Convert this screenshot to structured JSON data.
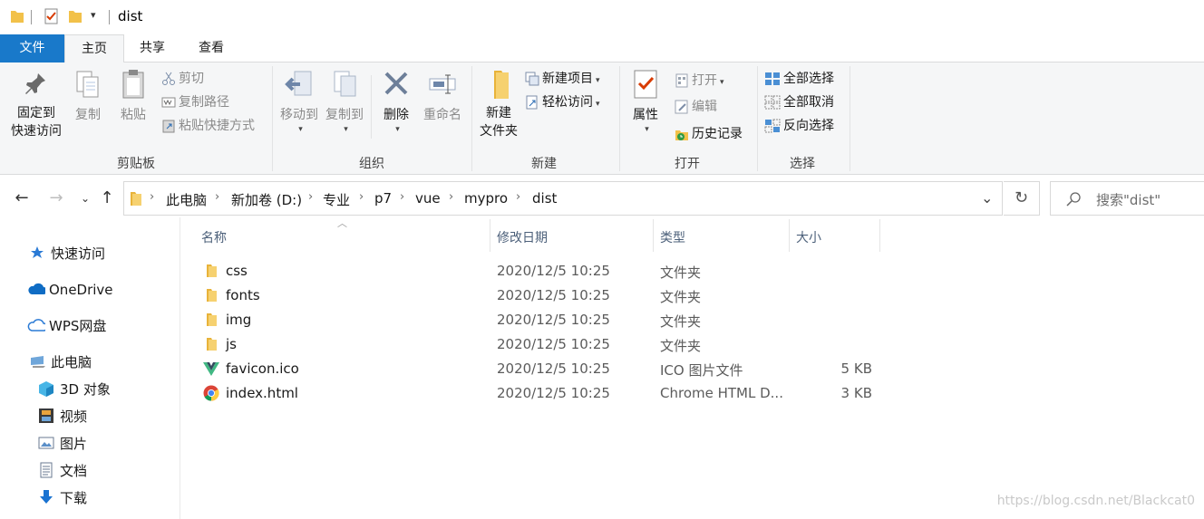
{
  "window": {
    "title": "dist"
  },
  "ribbon_tabs": [
    {
      "label": "文件"
    },
    {
      "label": "主页"
    },
    {
      "label": "共享"
    },
    {
      "label": "查看"
    }
  ],
  "ribbon": {
    "clipboard": {
      "group_label": "剪贴板",
      "pin_label": "固定到\n快速访问",
      "copy_label": "复制",
      "paste_label": "粘贴",
      "cut_label": "剪切",
      "copy_path_label": "复制路径",
      "paste_shortcut_label": "粘贴快捷方式"
    },
    "organize": {
      "group_label": "组织",
      "move_to_label": "移动到",
      "copy_to_label": "复制到",
      "delete_label": "删除",
      "rename_label": "重命名"
    },
    "new": {
      "group_label": "新建",
      "new_folder_label": "新建\n文件夹",
      "new_item_label": "新建项目",
      "easy_access_label": "轻松访问"
    },
    "open": {
      "group_label": "打开",
      "properties_label": "属性",
      "open_label": "打开",
      "edit_label": "编辑",
      "history_label": "历史记录"
    },
    "select": {
      "group_label": "选择",
      "select_all_label": "全部选择",
      "select_none_label": "全部取消",
      "invert_label": "反向选择"
    }
  },
  "address": {
    "crumbs": [
      "此电脑",
      "新加卷 (D:)",
      "专业",
      "p7",
      "vue",
      "mypro",
      "dist"
    ],
    "search_placeholder": "搜索\"dist\""
  },
  "nav_pane": {
    "quick_access": "快速访问",
    "onedrive": "OneDrive",
    "wps": "WPS网盘",
    "this_pc": "此电脑",
    "items": [
      "3D 对象",
      "视频",
      "图片",
      "文档",
      "下载"
    ]
  },
  "columns": {
    "name": "名称",
    "date": "修改日期",
    "type": "类型",
    "size": "大小"
  },
  "files": [
    {
      "name": "css",
      "date": "2020/12/5 10:25",
      "type": "文件夹",
      "size": "",
      "icon": "folder-icon"
    },
    {
      "name": "fonts",
      "date": "2020/12/5 10:25",
      "type": "文件夹",
      "size": "",
      "icon": "folder-icon"
    },
    {
      "name": "img",
      "date": "2020/12/5 10:25",
      "type": "文件夹",
      "size": "",
      "icon": "folder-icon"
    },
    {
      "name": "js",
      "date": "2020/12/5 10:25",
      "type": "文件夹",
      "size": "",
      "icon": "folder-icon"
    },
    {
      "name": "favicon.ico",
      "date": "2020/12/5 10:25",
      "type": "ICO 图片文件",
      "size": "5 KB",
      "icon": "vue-logo-icon"
    },
    {
      "name": "index.html",
      "date": "2020/12/5 10:25",
      "type": "Chrome HTML D...",
      "size": "3 KB",
      "icon": "chrome-icon"
    }
  ],
  "watermark": "https://blog.csdn.net/Blackcat0",
  "colors": {
    "file_tab": "#1979ca",
    "ribbon_bg": "#f5f6f7",
    "folder": "#f2c14a",
    "column_header": "#4c607a"
  }
}
